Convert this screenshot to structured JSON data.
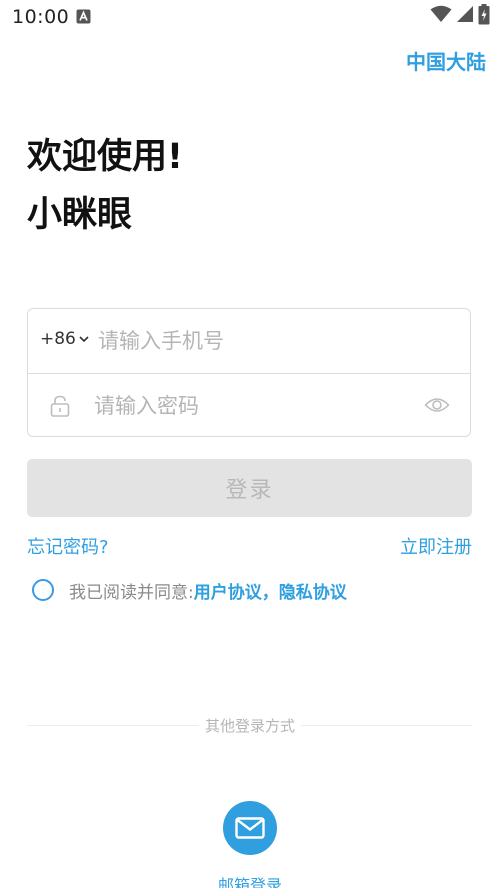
{
  "status_bar": {
    "time": "10:00",
    "icons": [
      "notification-a-icon",
      "wifi-icon",
      "cell-signal-icon",
      "battery-charging-icon"
    ]
  },
  "header": {
    "region": "中国大陆"
  },
  "welcome": {
    "title": "欢迎使用!",
    "app_name": "小眯眼"
  },
  "form": {
    "country_code": "+86",
    "phone_placeholder": "请输入手机号",
    "phone_value": "",
    "password_placeholder": "请输入密码",
    "password_value": "",
    "login_label": "登录",
    "forgot_password": "忘记密码?",
    "register": "立即注册"
  },
  "agreement": {
    "prefix": "我已阅读并同意:",
    "user_agreement": "用户协议",
    "separator": "，",
    "privacy_agreement": "隐私协议",
    "checked": false
  },
  "other_login": {
    "label": "其他登录方式",
    "email_login": "邮箱登录"
  },
  "colors": {
    "accent": "#2f9fe0",
    "disabled_button_bg": "#e3e3e3",
    "disabled_button_text": "#b8b8b8",
    "placeholder": "#b5b5b5"
  }
}
